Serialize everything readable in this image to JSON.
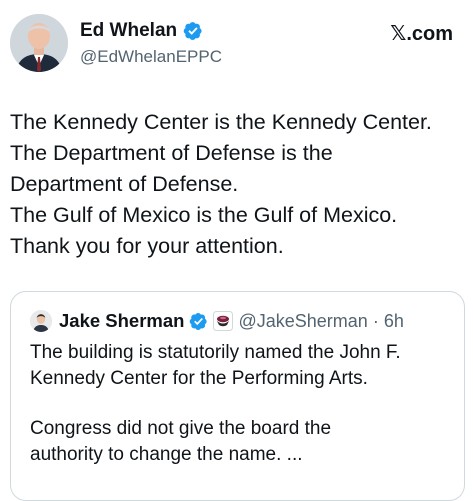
{
  "author": {
    "display_name": "Ed Whelan",
    "handle": "@EdWhelanEPPC",
    "verified": true
  },
  "source_label": {
    "mark": "𝕏",
    "text": ".com"
  },
  "tweet_lines": [
    "The Kennedy Center is the Kennedy Center.",
    "The Department of Defense is the",
    "Department of Defense.",
    "The Gulf of Mexico is the Gulf of Mexico.",
    "Thank you for your attention."
  ],
  "quoted_tweet": {
    "display_name": "Jake Sherman",
    "verified": true,
    "handle": "@JakeSherman",
    "separator": "·",
    "time": "6h",
    "paragraph1": [
      "The building is statutorily named the John F.",
      "Kennedy Center for the Performing Arts."
    ],
    "paragraph2": [
      "Congress did not give the board the",
      "authority to change the name. ..."
    ]
  },
  "colors": {
    "verified_blue": "#1d9bf0",
    "secondary_text": "#536471",
    "border": "#cfd9de"
  }
}
